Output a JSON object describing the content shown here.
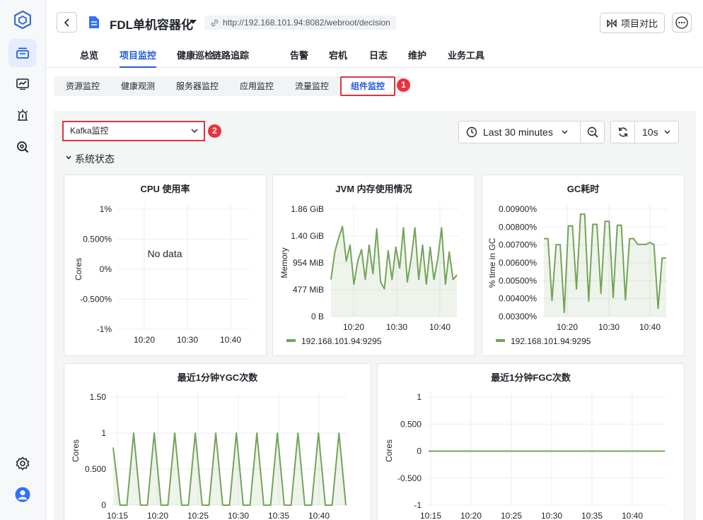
{
  "colors": {
    "accent": "#245bdb",
    "highlight": "#d9363e",
    "series": "#73a458"
  },
  "rail": {
    "items": [
      {
        "name": "logo-icon",
        "active": false
      },
      {
        "name": "stack-icon",
        "active": true
      },
      {
        "name": "line-chart-icon",
        "active": false
      },
      {
        "name": "alarm-icon",
        "active": false
      },
      {
        "name": "search-gear-icon",
        "active": false
      }
    ],
    "bottom": [
      "settings-icon",
      "user-avatar-icon"
    ]
  },
  "header": {
    "title": "FDL单机容器化",
    "url": "http://192.168.101.94:8082/webroot/decision",
    "compare_label": "项目对比"
  },
  "nav": {
    "tabs": [
      "总览",
      "项目监控",
      "健康巡检",
      "链路追踪",
      "告警",
      "宕机",
      "日志",
      "维护",
      "业务工具"
    ],
    "active": 1
  },
  "subnav": {
    "tabs": [
      "资源监控",
      "健康观测",
      "服务器监控",
      "应用监控",
      "流量监控",
      "组件监控"
    ],
    "active": 5,
    "badge": "1"
  },
  "toolbar": {
    "selector_value": "Kafka监控",
    "selector_badge": "2",
    "time_range": "Last 30 minutes",
    "refresh_interval": "10s"
  },
  "section": {
    "title": "系统状态"
  },
  "panels": {
    "cpu": {
      "title": "CPU 使用率",
      "no_data": "No data"
    },
    "jvm": {
      "title": "JVM 内存使用情况"
    },
    "gc": {
      "title": "GC耗时"
    },
    "ygc": {
      "title": "最近1分钟YGC次数"
    },
    "fgc": {
      "title": "最近1分钟FGC次数"
    }
  },
  "chart_data": [
    {
      "id": "cpu",
      "type": "line",
      "title": "CPU 使用率",
      "ylabel": "Cores",
      "yticks": [
        "1%",
        "0.500%",
        "0%",
        "-0.500%",
        "-1%"
      ],
      "xticks": [
        "10:20",
        "10:30",
        "10:40"
      ],
      "ylim": [
        -1,
        1
      ],
      "series": []
    },
    {
      "id": "jvm",
      "type": "area",
      "title": "JVM 内存使用情况",
      "ylabel": "Memory",
      "yticks": [
        "1.86 GiB",
        "1.40 GiB",
        "954 MiB",
        "477 MiB",
        "0 B"
      ],
      "xticks": [
        "10:20",
        "10:30",
        "10:40"
      ],
      "ylim": [
        0,
        1.86
      ],
      "y_unit": "GiB",
      "series": [
        {
          "name": "192.168.101.94:9295",
          "values": [
            0.64,
            1.12,
            1.36,
            1.56,
            0.96,
            1.24,
            0.56,
            0.96,
            1.16,
            0.64,
            1.24,
            0.74,
            1.52,
            0.6,
            0.48,
            1.14,
            0.64,
            1.2,
            0.84,
            1.54,
            0.6,
            1.0,
            1.54,
            0.64,
            1.24,
            0.56,
            1.2,
            0.64,
            1.0,
            1.54,
            0.56,
            1.12,
            0.64,
            0.72
          ]
        }
      ]
    },
    {
      "id": "gc",
      "type": "area",
      "title": "GC耗时",
      "ylabel": "% time in GC",
      "yticks": [
        "0.00900%",
        "0.00800%",
        "0.00700%",
        "0.00600%",
        "0.00500%",
        "0.00400%",
        "0.00300%"
      ],
      "xticks": [
        "10:20",
        "10:30",
        "10:40"
      ],
      "ylim": [
        0.003,
        0.009
      ],
      "y_unit": "%",
      "series": [
        {
          "name": "192.168.101.94:9295",
          "values": [
            0.00735,
            0.00735,
            0.0039,
            0.00702,
            0.00702,
            0.00323,
            0.00807,
            0.00807,
            0.00454,
            0.00872,
            0.00872,
            0.00386,
            0.00815,
            0.00815,
            0.0043,
            0.00832,
            0.00832,
            0.00406,
            0.0081,
            0.0081,
            0.00393,
            0.00735,
            0.00735,
            0.00703,
            0.00703,
            0.00703,
            0.00714,
            0.00702,
            0.00345,
            0.00627,
            0.00627
          ]
        }
      ]
    },
    {
      "id": "ygc",
      "type": "area",
      "title": "最近1分钟YGC次数",
      "ylabel": "Cores",
      "yticks": [
        "1.50",
        "1",
        "0.500",
        "0"
      ],
      "xticks": [
        "10:15",
        "10:20",
        "10:25",
        "10:30",
        "10:35",
        "10:40"
      ],
      "ylim": [
        0,
        1.5
      ],
      "series": [
        {
          "name": "",
          "values": [
            0.8,
            0,
            0,
            1,
            0,
            0,
            1,
            0,
            0,
            1,
            0,
            0,
            1,
            0,
            0,
            1,
            0,
            0,
            1,
            0,
            0,
            1,
            0,
            0,
            1,
            0,
            0,
            1,
            0,
            0,
            1,
            0,
            0,
            1,
            0
          ]
        }
      ]
    },
    {
      "id": "fgc",
      "type": "line",
      "title": "最近1分钟FGC次数",
      "ylabel": "Cores",
      "yticks": [
        "1",
        "0.500",
        "0",
        "-0.500",
        "-1"
      ],
      "xticks": [
        "10:15",
        "10:20",
        "10:25",
        "10:30",
        "10:35",
        "10:40"
      ],
      "ylim": [
        -1,
        1
      ],
      "series": [
        {
          "name": "",
          "values": [
            0,
            0
          ]
        }
      ]
    }
  ]
}
